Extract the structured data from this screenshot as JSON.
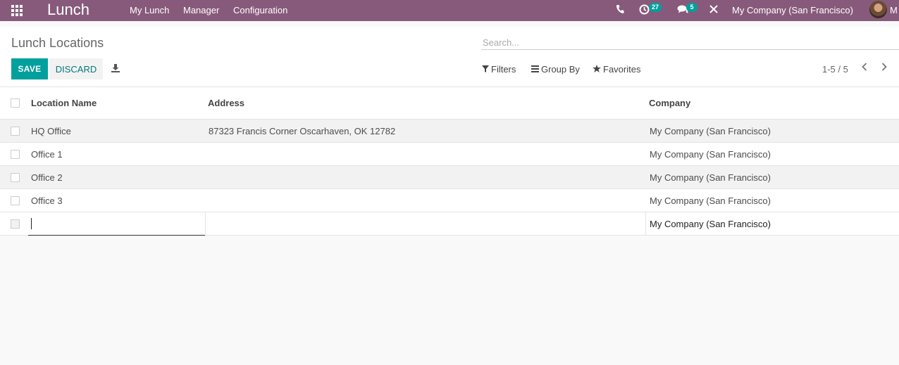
{
  "navbar": {
    "app_name": "Lunch",
    "menus": [
      "My Lunch",
      "Manager",
      "Configuration"
    ],
    "activity_count": "27",
    "message_count": "5",
    "company": "My Company (San Francisco)",
    "user_initial": "M"
  },
  "control": {
    "title": "Lunch Locations",
    "search_placeholder": "Search...",
    "save_label": "SAVE",
    "discard_label": "DISCARD",
    "filters_label": "Filters",
    "group_by_label": "Group By",
    "favorites_label": "Favorites",
    "pager": "1-5 / 5"
  },
  "table": {
    "headers": {
      "name": "Location Name",
      "address": "Address",
      "company": "Company"
    },
    "rows": [
      {
        "name": "HQ Office",
        "address": "87323 Francis Corner Oscarhaven, OK 12782",
        "company": "My Company (San Francisco)"
      },
      {
        "name": "Office 1",
        "address": "",
        "company": "My Company (San Francisco)"
      },
      {
        "name": "Office 2",
        "address": "",
        "company": "My Company (San Francisco)"
      },
      {
        "name": "Office 3",
        "address": "",
        "company": "My Company (San Francisco)"
      }
    ],
    "new_row": {
      "name": "",
      "address": "",
      "company": "My Company (San Francisco)"
    }
  },
  "colors": {
    "navbar": "#875a7b",
    "primary": "#00a09d",
    "link": "#00787d"
  }
}
